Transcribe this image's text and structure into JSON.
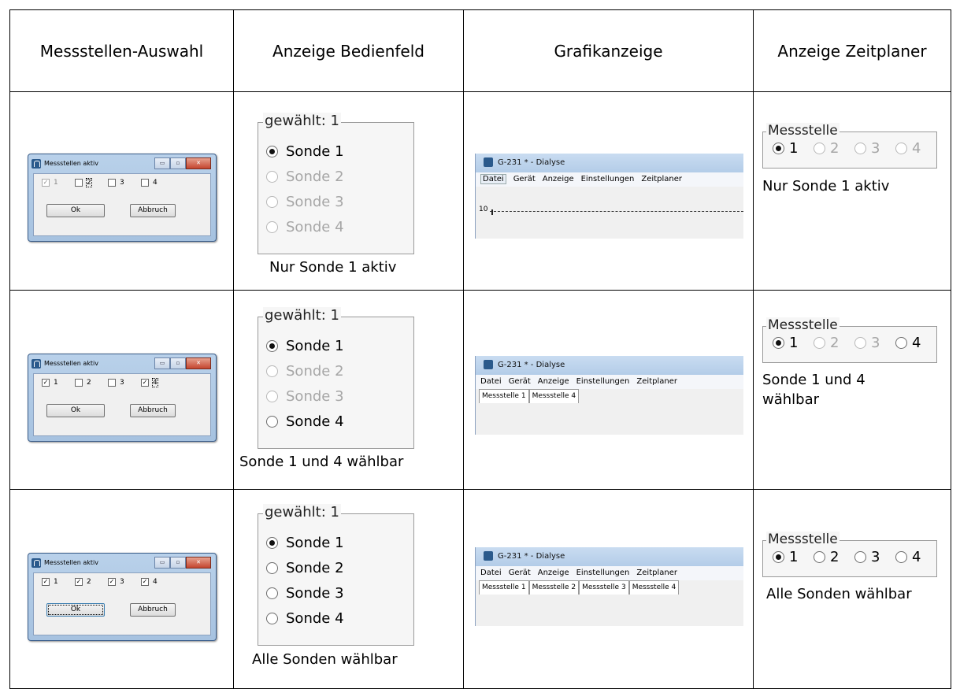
{
  "headers": [
    "Messstellen-Auswahl",
    "Anzeige Bedienfeld",
    "Grafikanzeige",
    "Anzeige Zeitplaner"
  ],
  "dialog": {
    "title": "Messstellen aktiv",
    "ok_label": "Ok",
    "cancel_label": "Abbruch",
    "min_glyph": "▭",
    "max_glyph": "▫",
    "close_glyph": "✕"
  },
  "rows": [
    {
      "checkboxes": [
        {
          "label": "1",
          "checked": true,
          "disabled": true
        },
        {
          "label": "2",
          "checked": false,
          "disabled": false
        },
        {
          "label": "3",
          "checked": false,
          "disabled": false
        },
        {
          "label": "4",
          "checked": false,
          "disabled": false
        }
      ],
      "panel": {
        "legend": "gewählt: 1",
        "sonden": [
          "Sonde 1",
          "Sonde 2",
          "Sonde 3",
          "Sonde 4"
        ],
        "caption": "Nur Sonde 1 aktiv"
      },
      "grafik": {
        "title": "G-231 * - Dialyse",
        "menu": [
          "Datei",
          "Gerät",
          "Anzeige",
          "Einstellungen",
          "Zeitplaner"
        ],
        "axis_label": "10"
      },
      "zeit": {
        "legend": "Messstelle",
        "options": [
          "1",
          "2",
          "3",
          "4"
        ],
        "caption": "Nur Sonde 1 aktiv"
      }
    },
    {
      "checkboxes": [
        {
          "label": "1",
          "checked": true
        },
        {
          "label": "2",
          "checked": false
        },
        {
          "label": "3",
          "checked": false
        },
        {
          "label": "4",
          "checked": true
        }
      ],
      "panel": {
        "legend": "gewählt: 1",
        "sonden": [
          "Sonde 1",
          "Sonde 2",
          "Sonde 3",
          "Sonde 4"
        ],
        "caption": "Sonde 1 und 4 wählbar"
      },
      "grafik": {
        "title": "G-231 * - Dialyse",
        "menu": [
          "Datei",
          "Gerät",
          "Anzeige",
          "Einstellungen",
          "Zeitplaner"
        ],
        "tabs": [
          "Messstelle 1",
          "Messstelle 4"
        ]
      },
      "zeit": {
        "legend": "Messstelle",
        "options": [
          "1",
          "2",
          "3",
          "4"
        ],
        "caption_line1": "Sonde 1 und 4",
        "caption_line2": "wählbar"
      }
    },
    {
      "checkboxes": [
        {
          "label": "1",
          "checked": true
        },
        {
          "label": "2",
          "checked": true
        },
        {
          "label": "3",
          "checked": true
        },
        {
          "label": "4",
          "checked": true
        }
      ],
      "panel": {
        "legend": "gewählt: 1",
        "sonden": [
          "Sonde 1",
          "Sonde 2",
          "Sonde 3",
          "Sonde 4"
        ],
        "caption": "Alle Sonden wählbar"
      },
      "grafik": {
        "title": "G-231 * - Dialyse",
        "menu": [
          "Datei",
          "Gerät",
          "Anzeige",
          "Einstellungen",
          "Zeitplaner"
        ],
        "tabs": [
          "Messstelle 1",
          "Messstelle 2",
          "Messstelle 3",
          "Messstelle 4"
        ]
      },
      "zeit": {
        "legend": "Messstelle",
        "options": [
          "1",
          "2",
          "3",
          "4"
        ],
        "caption": "Alle Sonden wählbar"
      }
    }
  ],
  "check_glyph": "✓"
}
